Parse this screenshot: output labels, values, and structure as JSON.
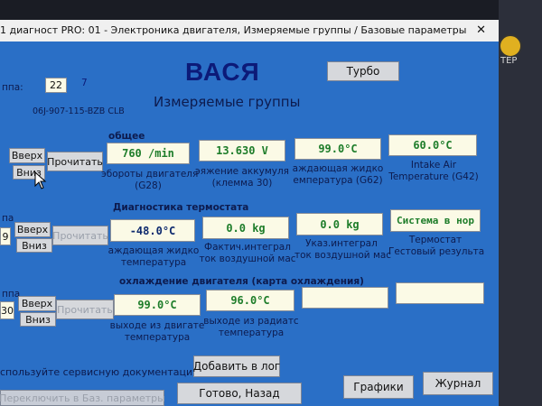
{
  "window": {
    "title": "1 диагност PRO: 01 - Электроника двигателя,  Измеряемые группы / Базовые параметры",
    "close_glyph": "✕"
  },
  "brand": "ВАСЯ",
  "turbo_label": "Турбо",
  "subtitle": "Измеряемые группы",
  "left_edge": {
    "group_label": "ппа:",
    "group_value": "22",
    "group_marker": "7",
    "part_number": "06J-907-115-BZB CLB"
  },
  "groups": [
    {
      "number_partial": "",
      "title": "общее",
      "up_label": "Вверх",
      "down_label": "Вниз",
      "read_label": "Прочитать",
      "fields": [
        {
          "value": "760 /min",
          "label1": "эбороты двигателя",
          "label2": "(G28)"
        },
        {
          "value": "13.630 V",
          "label1": "эяжение аккумуля",
          "label2": "(клемма 30)"
        },
        {
          "value": "99.0°C",
          "label1": "аждающая жидко",
          "label2": "емпература (G62)"
        },
        {
          "value": "60.0°C",
          "label1": "Intake Air",
          "label2": "Temperature (G42)"
        }
      ]
    },
    {
      "number_partial": "9",
      "title": "Диагностика термостата",
      "up_label": "Вверх",
      "down_label": "Вниз",
      "read_label": "Прочитать",
      "fields": [
        {
          "value": "-48.0°C",
          "label1": "аждающая жидко",
          "label2": "температура"
        },
        {
          "value": "0.0 kg",
          "label1": "Фактич.интеграл",
          "label2": "ток воздушной мас"
        },
        {
          "value": "0.0 kg",
          "label1": "Указ.интеграл",
          "label2": "ток воздушной мас"
        },
        {
          "value": "Система в нор",
          "label1": "Термостат",
          "label2": "Гестовый результа"
        }
      ]
    },
    {
      "number_partial": "30",
      "title": "охлаждение двигателя (карта охлаждения)",
      "up_label": "Вверх",
      "down_label": "Вниз",
      "read_label": "Прочитать",
      "fields": [
        {
          "value": "99.0°C",
          "label1": "выходе из двигате",
          "label2": "температура"
        },
        {
          "value": "96.0°C",
          "label1": "выходе из радиатс",
          "label2": "температура"
        },
        {
          "value": "",
          "label1": "",
          "label2": ""
        },
        {
          "value": "",
          "label1": "",
          "label2": ""
        }
      ]
    }
  ],
  "section_edge_labels": [
    "па",
    "ппа"
  ],
  "footer": {
    "hint": "спользуйте сервисную документацию!",
    "add_log": "Добавить в лог",
    "switch_basic": "Переключить в Баз. параметры",
    "done_back": "Готово, Назад",
    "graphs": "Графики",
    "journal": "Журнал"
  },
  "desktop": {
    "item_label": "ТЕР"
  }
}
